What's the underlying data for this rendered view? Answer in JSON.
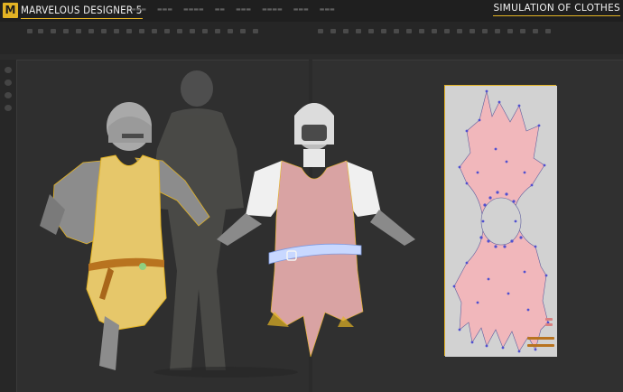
{
  "header": {
    "logo_letter": "M",
    "app_title": "MARVELOUS DESIGNER 5",
    "subtitle": "SIMULATION OF CLOTHES"
  },
  "colors": {
    "accent": "#e3b324",
    "dress_yellow": "#e6c76a",
    "dress_pink": "#d9a3a3",
    "armor_grey": "#8c8c8c",
    "pattern_points": "#5050d0",
    "belt_brown": "#b8731f",
    "belt_white": "#c8d8ff"
  },
  "icons": {
    "logo": "marvelous-logo-icon",
    "pattern_points": "vertex-point-icon"
  }
}
